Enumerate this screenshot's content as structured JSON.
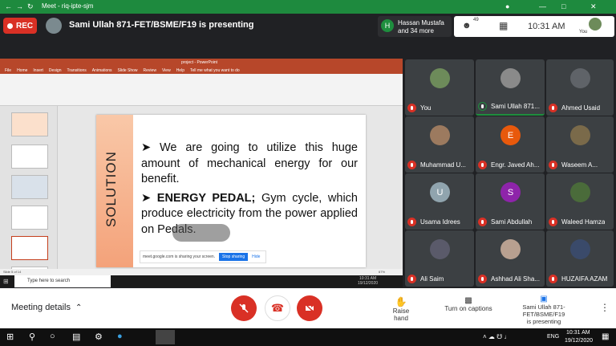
{
  "browser": {
    "title": "Meet - riq-ipte-sjm"
  },
  "topbar": {
    "rec_label": "REC",
    "presenting_text": "Sami Ullah 871-FET/BSME/F19 is presenting",
    "viewer_initial": "H",
    "viewer_name": "Hassan Mustafa",
    "viewer_more": "and 34 more",
    "participant_count": "49",
    "time": "10:31 AM",
    "you_label": "You"
  },
  "ppt": {
    "title": "project - PowerPoint",
    "tabs": [
      "File",
      "Home",
      "Insert",
      "Design",
      "Transitions",
      "Animations",
      "Slide Show",
      "Review",
      "View",
      "Help",
      "Tell me what you want to do"
    ],
    "slide_side_label": "SOLUTION",
    "bullet1": "We are going to utilize this huge amount of mechanical energy for our benefit.",
    "bullet2_bold": "ENERGY PEDAL;",
    "bullet2_rest": " Gym cycle, which produce electricity from the power applied on Pedals.",
    "share_text": "meet.google.com is sharing your screen.",
    "stop_sharing": "Stop sharing",
    "hide": "Hide",
    "status": "Slide 5 of 14",
    "zoom": "67%",
    "taskbar_search": "Type here to search",
    "taskbar_time": "10:31 AM",
    "taskbar_date": "19/12/2020"
  },
  "participants": [
    {
      "name": "You",
      "initial": "",
      "color": "#6d8b5a",
      "photo": true,
      "active": false
    },
    {
      "name": "Sami Ullah 871...",
      "initial": "",
      "color": "#8a8a8a",
      "photo": true,
      "active": true
    },
    {
      "name": "Ahmed Usaid",
      "initial": "",
      "color": "#5f6368",
      "photo": true,
      "active": false
    },
    {
      "name": "Muhammad U...",
      "initial": "",
      "color": "#9c7a5f",
      "photo": true,
      "active": false
    },
    {
      "name": "Engr. Javed Ah...",
      "initial": "E",
      "color": "#e8590c",
      "photo": false,
      "active": false
    },
    {
      "name": "Waseem A...",
      "initial": "",
      "color": "#7a6a4a",
      "photo": true,
      "active": false
    },
    {
      "name": "Usama Idrees",
      "initial": "U",
      "color": "#90a4ae",
      "photo": false,
      "active": false
    },
    {
      "name": "Sami Abdullah",
      "initial": "S",
      "color": "#8e24aa",
      "photo": false,
      "active": false
    },
    {
      "name": "Waleed Hamza",
      "initial": "",
      "color": "#4a6b3a",
      "photo": true,
      "active": false
    },
    {
      "name": "Ali Saim",
      "initial": "",
      "color": "#5a5a6a",
      "photo": true,
      "active": false
    },
    {
      "name": "Ashhad Ali Sha...",
      "initial": "",
      "color": "#b8a090",
      "photo": true,
      "active": false
    },
    {
      "name": "HUZAIFA AZAM",
      "initial": "",
      "color": "#3a4a6a",
      "photo": true,
      "active": false
    }
  ],
  "bottombar": {
    "meeting_details": "Meeting details",
    "raise_hand": "Raise hand",
    "captions": "Turn on captions",
    "presenter_line1": "Sami Ullah 871-FET/BSME/F19",
    "presenter_line2": "is presenting"
  },
  "taskbar": {
    "lang": "ENG",
    "time": "10:31 AM",
    "date": "19/12/2020"
  },
  "colors": {
    "meet_red": "#d93025",
    "chrome_green": "#1e8a3e",
    "ppt_orange": "#b7472a"
  }
}
